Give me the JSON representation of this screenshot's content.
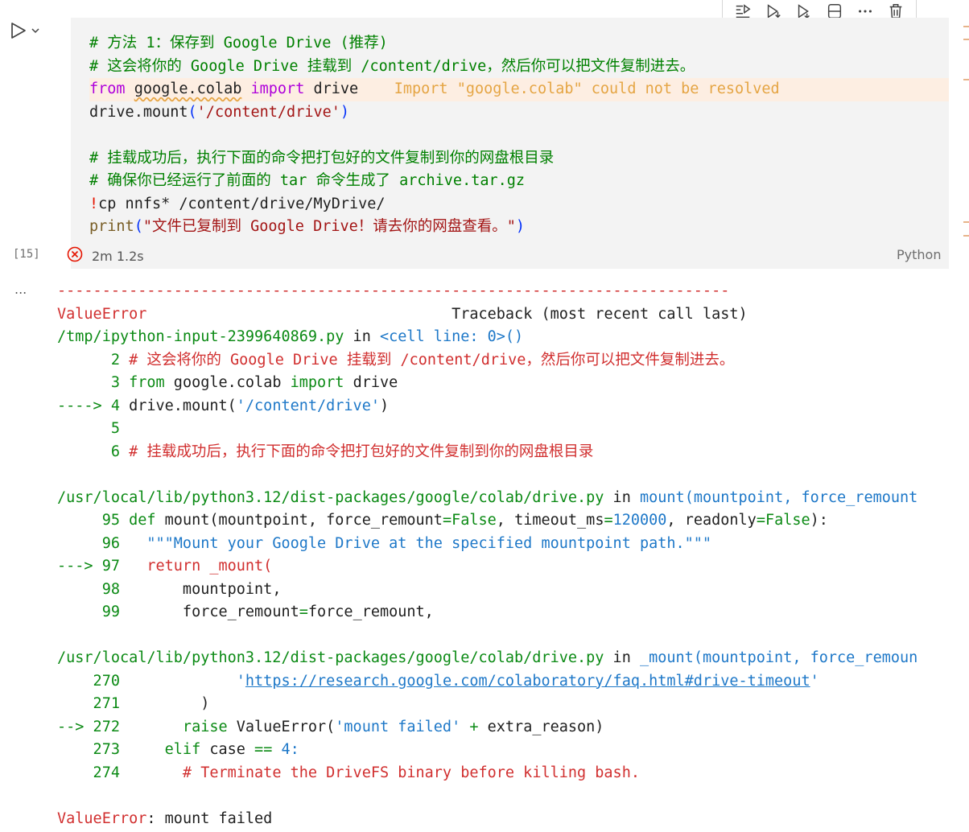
{
  "toolbar": {
    "icons": [
      "execute-above-icon",
      "execute-below-icon",
      "run-by-line-icon",
      "split-cell-icon",
      "more-icon",
      "delete-icon"
    ]
  },
  "cell": {
    "execution_count": "[15]",
    "duration": "2m 1.2s",
    "language": "Python",
    "code": {
      "l1": "# 方法 1：保存到 Google Drive (推荐)",
      "l2": "# 这会将你的 Google Drive 挂载到 /content/drive，然后你可以把文件复制进去。",
      "l3_from": "from",
      "l3_mod": "google.colab",
      "l3_import": "import",
      "l3_name": "drive",
      "l3_warning": "Import \"google.colab\" could not be resolved",
      "l4_obj": "drive.mount",
      "l4_arg": "'/content/drive'",
      "l6": "# 挂载成功后，执行下面的命令把打包好的文件复制到你的网盘根目录",
      "l7": "# 确保你已经运行了前面的 tar 命令生成了 archive.tar.gz",
      "l8_bang": "!",
      "l8_cmd": "cp nnfs* /content/drive/MyDrive/",
      "l9_fn": "print",
      "l9_arg": "\"文件已复制到 Google Drive！请去你的网盘查看。\""
    }
  },
  "output": {
    "more": "...",
    "rule": "---------------------------------------------------------------------------",
    "error_name": "ValueError",
    "traceback_label": "Traceback (most recent call last)",
    "frame1_file": "/tmp/ipython-input-2399640869.py",
    "frame1_in": " in ",
    "frame1_loc": "<cell line: 0>()",
    "f1_l2_no": "      2",
    "f1_l2_code": " # 这会将你的 Google Drive 挂载到 /content/drive，然后你可以把文件复制进去。",
    "f1_l3_no": "      3",
    "f1_l3_from": " from",
    "f1_l3_mod": " google.colab",
    "f1_l3_import": " import",
    "f1_l3_name": " drive",
    "f1_l4_arrow": "----> 4",
    "f1_l4_code": " drive.mount(",
    "f1_l4_arg": "'/content/drive'",
    "f1_l4_close": ")",
    "f1_l5_no": "      5",
    "f1_l6_no": "      6",
    "f1_l6_code": " # 挂载成功后，执行下面的命令把打包好的文件复制到你的网盘根目录",
    "frame2_file": "/usr/local/lib/python3.12/dist-packages/google/colab/drive.py",
    "frame2_in": " in ",
    "frame2_fn": "mount",
    "frame2_args": "(mountpoint, force_remount",
    "f2_95_no": "     95",
    "f2_95_def": " def",
    "f2_95_sig": " mount(mountpoint, force_remount",
    "f2_95_eq1": "=",
    "f2_95_false1": "False",
    "f2_95_t": ", timeout_ms",
    "f2_95_eq2": "=",
    "f2_95_num": "120000",
    "f2_95_r": ", readonly",
    "f2_95_eq3": "=",
    "f2_95_false2": "False",
    "f2_95_end": "):",
    "f2_96_no": "     96",
    "f2_96_doc": "   \"\"\"Mount your Google Drive at the specified mountpoint path.\"\"\"",
    "f2_97_arrow": "---> 97",
    "f2_97_ret": "   return",
    "f2_97_call": " _mount(",
    "f2_98_no": "     98",
    "f2_98_code": "       mountpoint,",
    "f2_99_no": "     99",
    "f2_99_a": "       force_remount",
    "f2_99_eq": "=",
    "f2_99_b": "force_remount,",
    "frame3_file": "/usr/local/lib/python3.12/dist-packages/google/colab/drive.py",
    "frame3_in": " in ",
    "frame3_fn": "_mount",
    "frame3_args": "(mountpoint, force_remoun",
    "f3_270_no": "    270",
    "f3_270_pad": "             '",
    "f3_270_link": "https://research.google.com/colaboratory/faq.html#drive-timeout",
    "f3_270_end": "'",
    "f3_271_no": "    271",
    "f3_271_code": "         )",
    "f3_272_arrow": "--> 272",
    "f3_272_raise": "       raise",
    "f3_272_a": " ValueError(",
    "f3_272_str": "'mount failed'",
    "f3_272_plus": " +",
    "f3_272_b": " extra_reason)",
    "f3_273_no": "    273",
    "f3_273_elif": "     elif",
    "f3_273_a": " case",
    "f3_273_eq": " ==",
    "f3_273_num": " 4:",
    "f3_274_no": "    274",
    "f3_274_cm": "       # Terminate the DriveFS binary before killing bash.",
    "final_name": "ValueError",
    "final_msg": ": mount failed"
  }
}
